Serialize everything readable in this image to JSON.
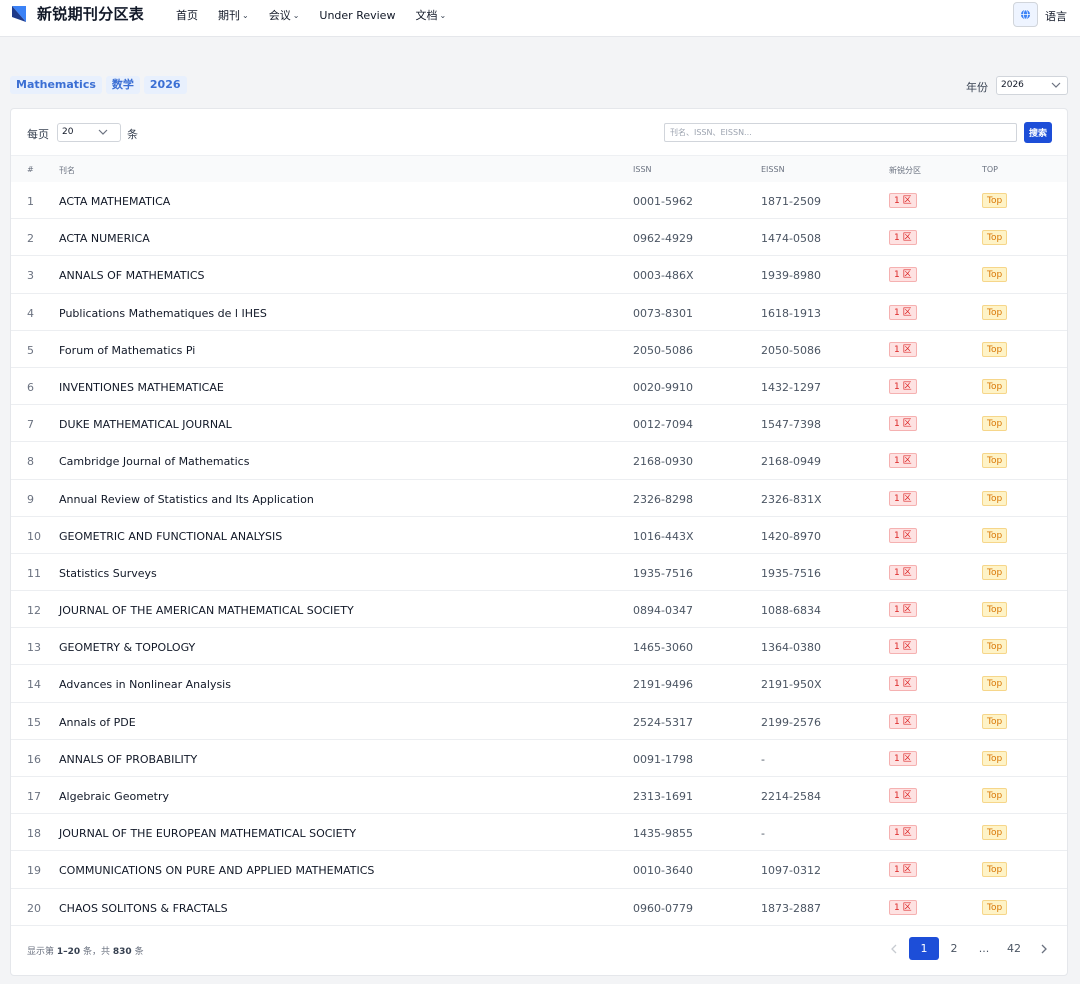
{
  "header": {
    "brand": "新锐期刊分区表",
    "nav": [
      {
        "label": "首页",
        "dropdown": false
      },
      {
        "label": "期刊",
        "dropdown": true
      },
      {
        "label": "会议",
        "dropdown": true
      },
      {
        "label": "Under Review",
        "dropdown": false
      },
      {
        "label": "文档",
        "dropdown": true
      }
    ],
    "language_label": "语言",
    "colors": {
      "brand_blue": "#1d4ed8",
      "logo_dark": "#1e3a8a",
      "logo_light": "#3b82f6"
    }
  },
  "filters": {
    "chips": [
      "Mathematics",
      "数学",
      "2026"
    ],
    "year_label": "年份",
    "year_value": "2026"
  },
  "toolbar": {
    "per_page_label": "每页",
    "per_page_value": "20",
    "per_page_unit": "条",
    "search_placeholder": "刊名、ISSN、EISSN...",
    "search_button": "搜索"
  },
  "table": {
    "headers": [
      "#",
      "刊名",
      "ISSN",
      "EISSN",
      "新锐分区",
      "TOP"
    ],
    "rows": [
      {
        "idx": "1",
        "name": "ACTA MATHEMATICA",
        "issn": "0001-5962",
        "eissn": "1871-2509",
        "zone": "1 区",
        "top": "Top"
      },
      {
        "idx": "2",
        "name": "ACTA NUMERICA",
        "issn": "0962-4929",
        "eissn": "1474-0508",
        "zone": "1 区",
        "top": "Top"
      },
      {
        "idx": "3",
        "name": "ANNALS OF MATHEMATICS",
        "issn": "0003-486X",
        "eissn": "1939-8980",
        "zone": "1 区",
        "top": "Top"
      },
      {
        "idx": "4",
        "name": "Publications Mathematiques de l IHES",
        "issn": "0073-8301",
        "eissn": "1618-1913",
        "zone": "1 区",
        "top": "Top"
      },
      {
        "idx": "5",
        "name": "Forum of Mathematics Pi",
        "issn": "2050-5086",
        "eissn": "2050-5086",
        "zone": "1 区",
        "top": "Top"
      },
      {
        "idx": "6",
        "name": "INVENTIONES MATHEMATICAE",
        "issn": "0020-9910",
        "eissn": "1432-1297",
        "zone": "1 区",
        "top": "Top"
      },
      {
        "idx": "7",
        "name": "DUKE MATHEMATICAL JOURNAL",
        "issn": "0012-7094",
        "eissn": "1547-7398",
        "zone": "1 区",
        "top": "Top"
      },
      {
        "idx": "8",
        "name": "Cambridge Journal of Mathematics",
        "issn": "2168-0930",
        "eissn": "2168-0949",
        "zone": "1 区",
        "top": "Top"
      },
      {
        "idx": "9",
        "name": "Annual Review of Statistics and Its Application",
        "issn": "2326-8298",
        "eissn": "2326-831X",
        "zone": "1 区",
        "top": "Top"
      },
      {
        "idx": "10",
        "name": "GEOMETRIC AND FUNCTIONAL ANALYSIS",
        "issn": "1016-443X",
        "eissn": "1420-8970",
        "zone": "1 区",
        "top": "Top"
      },
      {
        "idx": "11",
        "name": "Statistics Surveys",
        "issn": "1935-7516",
        "eissn": "1935-7516",
        "zone": "1 区",
        "top": "Top"
      },
      {
        "idx": "12",
        "name": "JOURNAL OF THE AMERICAN MATHEMATICAL SOCIETY",
        "issn": "0894-0347",
        "eissn": "1088-6834",
        "zone": "1 区",
        "top": "Top"
      },
      {
        "idx": "13",
        "name": "GEOMETRY & TOPOLOGY",
        "issn": "1465-3060",
        "eissn": "1364-0380",
        "zone": "1 区",
        "top": "Top"
      },
      {
        "idx": "14",
        "name": "Advances in Nonlinear Analysis",
        "issn": "2191-9496",
        "eissn": "2191-950X",
        "zone": "1 区",
        "top": "Top"
      },
      {
        "idx": "15",
        "name": "Annals of PDE",
        "issn": "2524-5317",
        "eissn": "2199-2576",
        "zone": "1 区",
        "top": "Top"
      },
      {
        "idx": "16",
        "name": "ANNALS OF PROBABILITY",
        "issn": "0091-1798",
        "eissn": "-",
        "zone": "1 区",
        "top": "Top"
      },
      {
        "idx": "17",
        "name": "Algebraic Geometry",
        "issn": "2313-1691",
        "eissn": "2214-2584",
        "zone": "1 区",
        "top": "Top"
      },
      {
        "idx": "18",
        "name": "JOURNAL OF THE EUROPEAN MATHEMATICAL SOCIETY",
        "issn": "1435-9855",
        "eissn": "-",
        "zone": "1 区",
        "top": "Top"
      },
      {
        "idx": "19",
        "name": "COMMUNICATIONS ON PURE AND APPLIED MATHEMATICS",
        "issn": "0010-3640",
        "eissn": "1097-0312",
        "zone": "1 区",
        "top": "Top"
      },
      {
        "idx": "20",
        "name": "CHAOS SOLITONS & FRACTALS",
        "issn": "0960-0779",
        "eissn": "1873-2887",
        "zone": "1 区",
        "top": "Top"
      }
    ]
  },
  "footer": {
    "info_prefix": "显示第 ",
    "info_range": "1–20",
    "info_middle": " 条，共 ",
    "info_total": "830",
    "info_suffix": " 条",
    "pages": [
      "1",
      "2",
      "...",
      "42"
    ],
    "active_page": "1"
  }
}
